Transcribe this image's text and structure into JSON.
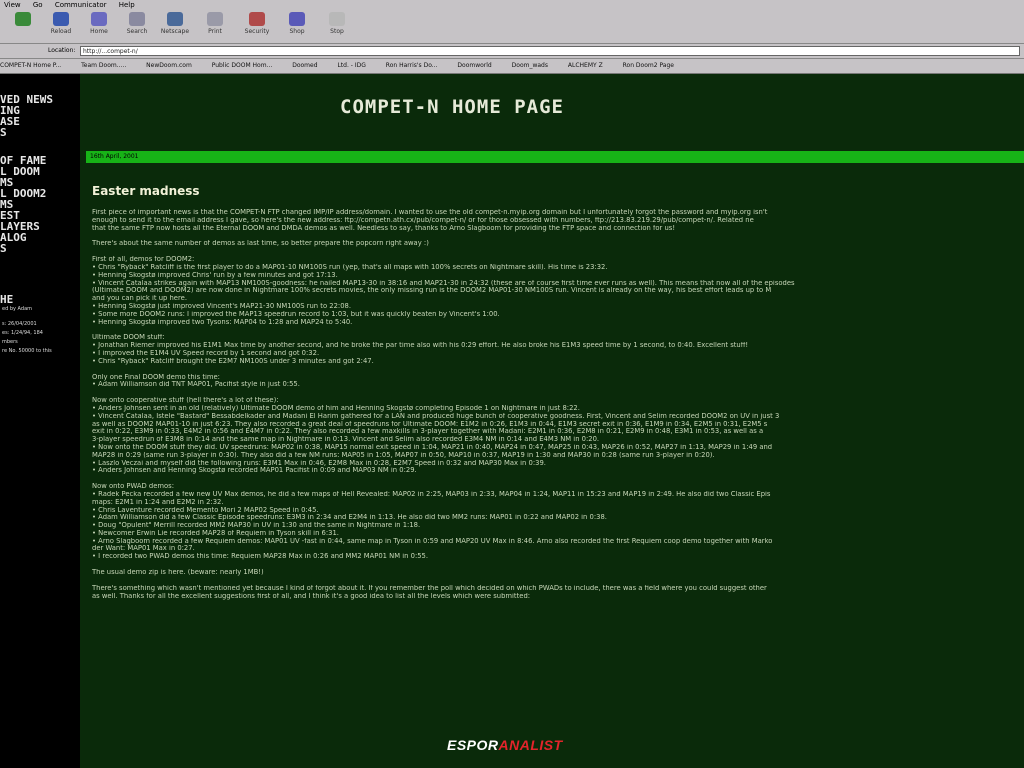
{
  "browser": {
    "menu": [
      "View",
      "Go",
      "Communicator",
      "Help"
    ],
    "toolbar": [
      "Reload",
      "Home",
      "Search",
      "Netscape",
      "Print",
      "Security",
      "Shop",
      "Stop"
    ],
    "location_label": "Location:",
    "location_value": "http://...compet-n/",
    "bookmarks": [
      "COMPET-N Home P...",
      "Team Doom.....",
      "NewDoom.com",
      "Public DOOM Hom...",
      "Doomed",
      "Ltd. - IDG",
      "Ron Harris's Do...",
      "Doomworld",
      "Doom_wads",
      "ALCHEMY Z",
      "Ron Doom2 Page"
    ]
  },
  "sidebar": {
    "nav": [
      "VED NEWS",
      "ING",
      "ASE",
      "S",
      "OF FAME",
      "L DOOM",
      "MS",
      "L DOOM2",
      "MS",
      "EST",
      "LAYERS",
      "ALOG",
      "S"
    ],
    "info": [
      "HE",
      "ed by Adam",
      "s: 26/04/2001",
      "es: 1/24/94, 184",
      "mbers",
      "re No. 50000 to this"
    ]
  },
  "header": {
    "title": "COMPET-N HOME PAGE",
    "date": "16th April, 2001",
    "heading": "Easter madness"
  },
  "content": {
    "intro": [
      "First piece of important news is that the COMPET-N FTP changed IMP/IP address/domain. I wanted to use the old compet-n.myip.org domain but I unfortunately forgot the password and myip.org isn't",
      "enough to send it to the email address I gave, so here's the new address: ftp://competn.ath.cx/pub/compet-n/ or for those obsessed with numbers, ftp://213.83.219.29/pub/compet-n/. Related ne",
      "that the same FTP now hosts all the Eternal DOOM and DMDA demos as well. Needless to say, thanks to Arno Slagboom for providing the FTP space and connection for us!"
    ],
    "popcorn": "There's about the same number of demos as last time, so better prepare the popcorn right away :)",
    "doom2": [
      "First of all, demos for DOOM2:",
      "• Chris \"Ryback\" Ratcliff is the first player to do a MAP01-10 NM100S run (yep, that's all maps with 100% secrets on Nightmare skill). His time is 23:32.",
      "• Henning Skogstø improved Chris' run by a few minutes and got 17:13.",
      "• Vincent Catalaa strikes again with MAP13 NM100S-goodness: he nailed MAP13-30 in 38:16 and MAP21-30 in 24:32 (these are of course first time ever runs as well). This means that now all of the episodes",
      "(Ultimate DOOM and DOOM2) are now done in Nightmare 100% secrets movies, the only missing run is the DOOM2 MAP01-30 NM100S run. Vincent is already on the way, his best effort leads up to M",
      "and you can pick it up here.",
      "• Henning Skogstø just improved Vincent's MAP21-30 NM100S run to 22:08.",
      "• Some more DOOM2 runs: I improved the MAP13 speedrun record to 1:03, but it was quickly beaten by Vincent's 1:00.",
      "• Henning Skogstø improved two Tysons: MAP04 to 1:28 and MAP24 to 5:40."
    ],
    "ultimate": [
      "Ultimate DOOM stuff:",
      "• Jonathan Riemer improved his E1M1 Max time by another second, and he broke the par time also with his 0:29 effort. He also broke his E1M3 speed time by 1 second, to 0:40. Excellent stuff!",
      "• I improved the E1M4 UV Speed record by 1 second and got 0:32.",
      "• Chris \"Ryback\" Ratcliff brought the E2M7 NM100S under 3 minutes and got 2:47."
    ],
    "final": [
      "Only one Final DOOM demo this time:",
      "• Adam Williamson did TNT MAP01, Pacifist style in just 0:55."
    ],
    "coop": [
      "Now onto cooperative stuff (hell there's a lot of these):",
      "• Anders Johnsen sent in an old (relatively) Ultimate DOOM demo of him and Henning Skogstø completing Episode 1 on Nightmare in just 8:22.",
      "• Vincent Catalaa, Istele \"Bastard\" Bessabdelkader and Madani El Harim gathered for a LAN and produced huge bunch of cooperative goodness. First, Vincent and Selim recorded DOOM2 on UV in just 3",
      "as well as DOOM2 MAP01-10 in just 6:23. They also recorded a great deal of speedruns for Ultimate DOOM: E1M2 in 0:26, E1M3 in 0:44, E1M3 secret exit in 0:36, E1M9 in 0:34, E2M5 in 0:31, E2M5 s",
      "exit in 0:22, E3M9 in 0:33, E4M2 in 0:56 and E4M7 in 0:22. They also recorded a few maxkills in 3-player together with Madani: E2M1 in 0:36, E2M8 in 0:21, E2M9 in 0:48, E3M1 in 0:53, as well as a",
      "3-player speedrun of E3M8 in 0:14 and the same map in Nightmare in 0:13. Vincent and Selim also recorded E3M4 NM in 0:14 and E4M3 NM in 0:20.",
      "• Now onto the DOOM stuff they did. UV speedruns: MAP02 in 0:38, MAP15 normal exit speed in 1:04, MAP21 in 0:40, MAP24 in 0:47, MAP25 in 0:43, MAP26 in 0:52, MAP27 in 1:13, MAP29 in 1:49 and",
      "MAP28 in 0:29 (same run 3-player in 0:30). They also did a few NM runs: MAP05 in 1:05, MAP07 in 0:50, MAP10 in 0:37, MAP19 in 1:30 and MAP30 in 0:28 (same run 3-player in 0:20).",
      "• Laszlo Veczai and myself did the following runs: E3M1 Max in 0:46, E2M8 Max in 0:28, E2M7 Speed in 0:32 and MAP30 Max in 0:39.",
      "• Anders Johnsen and Henning Skogstø recorded MAP01 Pacifist in 0:09 and MAP03 NM in 0:29."
    ],
    "pwad": [
      "Now onto PWAD demos:",
      "• Radek Pecka recorded a few new UV Max demos, he did a few maps of Hell Revealed: MAP02 in 2:25, MAP03 in 2:33, MAP04 in 1:24, MAP11 in 15:23 and MAP19 in 2:49. He also did two Classic Epis",
      "maps: E2M1 in 1:24 and E2M2 in 2:32.",
      "• Chris Laventure recorded Memento Mori 2 MAP02 Speed in 0:45.",
      "• Adam Williamson did a few Classic Episode speedruns: E3M3 in 2:34 and E2M4 in 1:13. He also did two MM2 runs: MAP01 in 0:22 and MAP02 in 0:38.",
      "• Doug \"Opulent\" Merrill recorded MM2 MAP30 in UV in 1:30 and the same in Nightmare in 1:18.",
      "• Newcomer Erwin Lie recorded MAP28 of Requiem in Tyson skill in 6:31.",
      "• Arno Slagboom recorded a few Requiem demos: MAP01 UV -fast in 0:44, same map in Tyson in 0:59 and MAP20 UV Max in 8:46. Arno also recorded the first Requiem coop demo together with Marko",
      "der Want: MAP01 Max in 0:27.",
      "• I recorded two PWAD demos this time: Requiem MAP28 Max in 0:26 and MM2 MAP01 NM in 0:55."
    ],
    "zip": "The usual demo zip is here. (beware: nearly 1MB!)",
    "closing": [
      "There's something which wasn't mentioned yet because I kind of forgot about it. If you remember the poll which decided on which PWADs to include, there was a field where you could suggest other",
      "as well. Thanks for all the excellent suggestions first of all, and I think it's a good idea to list all the levels which were submitted:"
    ]
  },
  "watermark": {
    "part1": "ESPOR",
    "part2": "ANALIST"
  }
}
